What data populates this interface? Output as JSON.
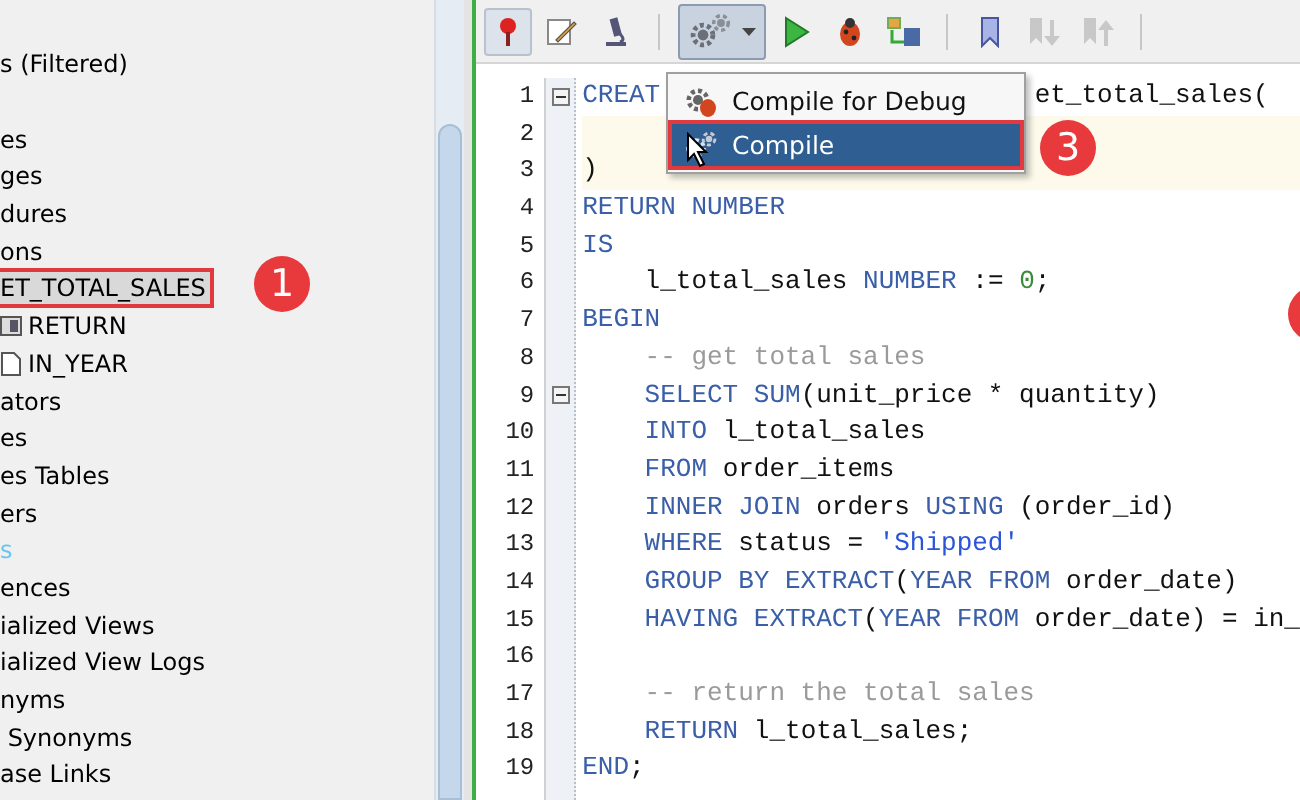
{
  "navigator": {
    "connection_label": "s (Filtered)",
    "items": [
      {
        "label": "es",
        "selected": false,
        "color": "#000000"
      },
      {
        "label": "ges",
        "selected": false,
        "color": "#000000"
      },
      {
        "label": "dures",
        "selected": false,
        "color": "#000000"
      },
      {
        "label": "ons",
        "selected": false,
        "color": "#000000"
      },
      {
        "label": "ET_TOTAL_SALES",
        "selected": true,
        "color": "#000000",
        "children": [
          {
            "label": "RETURN",
            "kind": "return"
          },
          {
            "label": "IN_YEAR",
            "kind": "param"
          }
        ]
      },
      {
        "label": "ators",
        "selected": false,
        "color": "#000000"
      },
      {
        "label": "es",
        "selected": false,
        "color": "#000000"
      },
      {
        "label": "es Tables",
        "selected": false,
        "color": "#000000"
      },
      {
        "label": "ers",
        "selected": false,
        "color": "#000000"
      },
      {
        "label": "s",
        "selected": false,
        "color": "#6cc4f0"
      },
      {
        "label": "ences",
        "selected": false,
        "color": "#000000"
      },
      {
        "label": "ialized Views",
        "selected": false,
        "color": "#000000"
      },
      {
        "label": "ialized View Logs",
        "selected": false,
        "color": "#000000"
      },
      {
        "label": "nyms",
        "selected": false,
        "color": "#000000"
      },
      {
        "label": " Synonyms",
        "selected": false,
        "color": "#000000"
      },
      {
        "label": "ase Links",
        "selected": false,
        "color": "#000000"
      }
    ]
  },
  "toolbar": [
    {
      "kind": "pin",
      "disabled": false
    },
    {
      "kind": "pencil",
      "disabled": false
    },
    {
      "kind": "microscope",
      "disabled": false
    },
    {
      "kind": "separator"
    },
    {
      "kind": "gears",
      "disabled": false
    },
    {
      "kind": "play",
      "disabled": false
    },
    {
      "kind": "bug",
      "disabled": false
    },
    {
      "kind": "flow",
      "disabled": false
    },
    {
      "kind": "separator"
    },
    {
      "kind": "bookmark",
      "disabled": false
    },
    {
      "kind": "down",
      "disabled": true
    },
    {
      "kind": "up",
      "disabled": true
    },
    {
      "kind": "separator"
    }
  ],
  "menu": [
    {
      "label": "Compile for Debug",
      "selected": false,
      "kind": "debug"
    },
    {
      "label": "Compile",
      "selected": true,
      "kind": "compile"
    }
  ],
  "editor": {
    "lines": [
      {
        "number": "1",
        "fold": true,
        "current": false,
        "segments": [
          [
            {
              "text": "CREAT",
              "kind": "keyword"
            }
          ],
          [
            {
              "text": "et_total_sales(",
              "kind": "plain"
            }
          ]
        ]
      },
      {
        "number": "2",
        "fold": false,
        "current": true
      },
      {
        "number": "3",
        "fold": false,
        "current": true,
        "segments": [
          [
            {
              "text": ")",
              "kind": "plain"
            }
          ]
        ]
      },
      {
        "number": "4",
        "fold": false,
        "current": false,
        "segments": [
          [
            {
              "text": "RETURN NUMBER",
              "kind": "keyword"
            }
          ]
        ]
      },
      {
        "number": "5",
        "fold": false,
        "current": false,
        "segments": [
          [
            {
              "text": "IS",
              "kind": "keyword"
            }
          ]
        ]
      },
      {
        "number": "6",
        "fold": false,
        "current": false,
        "segments": [
          [
            {
              "text": "    l_total_sales ",
              "kind": "plain"
            },
            {
              "text": "NUMBER",
              "kind": "keyword"
            },
            {
              "text": " := ",
              "kind": "plain"
            },
            {
              "text": "0",
              "kind": "number"
            },
            {
              "text": ";",
              "kind": "plain"
            }
          ]
        ]
      },
      {
        "number": "7",
        "fold": false,
        "current": false,
        "segments": [
          [
            {
              "text": "BEGIN",
              "kind": "keyword"
            }
          ]
        ]
      },
      {
        "number": "8",
        "fold": false,
        "current": false,
        "segments": [
          [
            {
              "text": "    -- get total sales",
              "kind": "comment"
            }
          ]
        ]
      },
      {
        "number": "9",
        "fold": true,
        "current": false,
        "segments": [
          [
            {
              "text": "    SELECT SUM",
              "kind": "keyword"
            },
            {
              "text": "(unit_price * quantity)",
              "kind": "plain"
            }
          ]
        ]
      },
      {
        "number": "10",
        "fold": false,
        "current": false,
        "segments": [
          [
            {
              "text": "    INTO",
              "kind": "keyword"
            },
            {
              "text": " l_total_sales",
              "kind": "plain"
            }
          ]
        ]
      },
      {
        "number": "11",
        "fold": false,
        "current": false,
        "segments": [
          [
            {
              "text": "    FROM",
              "kind": "keyword"
            },
            {
              "text": " order_items",
              "kind": "plain"
            }
          ]
        ]
      },
      {
        "number": "12",
        "fold": false,
        "current": false,
        "segments": [
          [
            {
              "text": "    INNER JOIN",
              "kind": "keyword"
            },
            {
              "text": " orders ",
              "kind": "plain"
            },
            {
              "text": "USING",
              "kind": "keyword"
            },
            {
              "text": " (order_id)",
              "kind": "plain"
            }
          ]
        ]
      },
      {
        "number": "13",
        "fold": false,
        "current": false,
        "segments": [
          [
            {
              "text": "    WHERE",
              "kind": "keyword"
            },
            {
              "text": " status = ",
              "kind": "plain"
            },
            {
              "text": "'Shipped'",
              "kind": "string"
            }
          ]
        ]
      },
      {
        "number": "14",
        "fold": false,
        "current": false,
        "segments": [
          [
            {
              "text": "    GROUP BY EXTRACT",
              "kind": "keyword"
            },
            {
              "text": "(",
              "kind": "plain"
            },
            {
              "text": "YEAR FROM",
              "kind": "keyword"
            },
            {
              "text": " order_date)",
              "kind": "plain"
            }
          ]
        ]
      },
      {
        "number": "15",
        "fold": false,
        "current": false,
        "segments": [
          [
            {
              "text": "    HAVING EXTRACT",
              "kind": "keyword"
            },
            {
              "text": "(",
              "kind": "plain"
            },
            {
              "text": "YEAR FROM",
              "kind": "keyword"
            },
            {
              "text": " order_date) = in_",
              "kind": "plain"
            }
          ]
        ]
      },
      {
        "number": "16",
        "fold": false,
        "current": false
      },
      {
        "number": "17",
        "fold": false,
        "current": false,
        "segments": [
          [
            {
              "text": "    -- return the total sales",
              "kind": "comment"
            }
          ]
        ]
      },
      {
        "number": "18",
        "fold": false,
        "current": false,
        "segments": [
          [
            {
              "text": "    RETURN",
              "kind": "keyword"
            },
            {
              "text": " l_total_sales;",
              "kind": "plain"
            }
          ]
        ]
      },
      {
        "number": "19",
        "fold": false,
        "current": false,
        "segments": [
          [
            {
              "text": "END",
              "kind": "keyword"
            },
            {
              "text": ";",
              "kind": "plain"
            }
          ]
        ]
      }
    ]
  },
  "callouts": [
    {
      "text": "1",
      "kind": "tree"
    },
    {
      "text": "3",
      "kind": "menu"
    },
    {
      "kind": "edge"
    }
  ]
}
